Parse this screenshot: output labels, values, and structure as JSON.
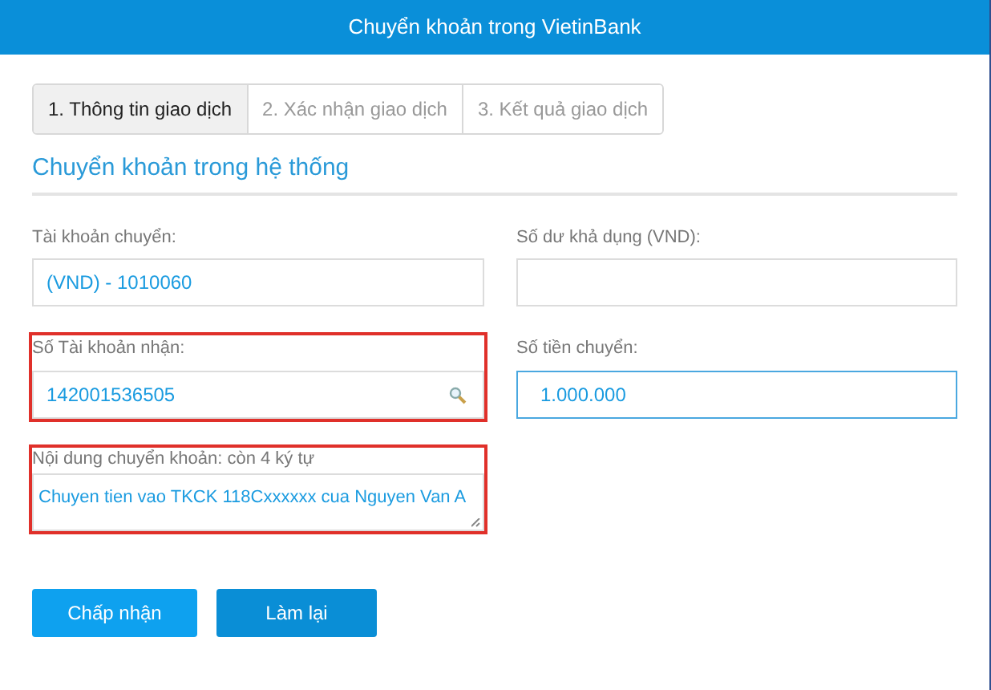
{
  "window": {
    "title": "Chuyển khoản trong VietinBank"
  },
  "steps": [
    {
      "label": "1. Thông tin giao dịch",
      "selected": true
    },
    {
      "label": "2. Xác nhận giao dịch",
      "selected": false
    },
    {
      "label": "3. Kết quả giao dịch",
      "selected": false
    }
  ],
  "section_title": "Chuyển khoản trong hệ thống",
  "fields": [
    {
      "kind": "input",
      "label": "Tài khoản chuyển:",
      "value": "(VND) - 1010060",
      "highlighted": false,
      "focused": false,
      "search": false
    },
    {
      "kind": "input",
      "label": "Số dư khả dụng (VND):",
      "highlighted": false,
      "focused": false,
      "search": false
    },
    {
      "kind": "input",
      "label": "Số Tài khoản nhận:",
      "value": "142001536505",
      "highlighted": true,
      "focused": false,
      "search": true
    },
    {
      "kind": "input",
      "label": "Số tiền chuyển:",
      "value": "1.000.000",
      "highlighted": false,
      "focused": true,
      "search": false
    },
    {
      "kind": "textarea",
      "label": "Nội dung chuyển khoản: còn 4 ký tự",
      "value": "Chuyen tien vao TKCK 118Cxxxxxx cua Nguyen Van A",
      "highlighted": true,
      "focused": false
    }
  ],
  "buttons": [
    {
      "label": "Chấp nhận",
      "kind": "primary"
    },
    {
      "label": "Làm lại",
      "kind": "secondary"
    }
  ]
}
